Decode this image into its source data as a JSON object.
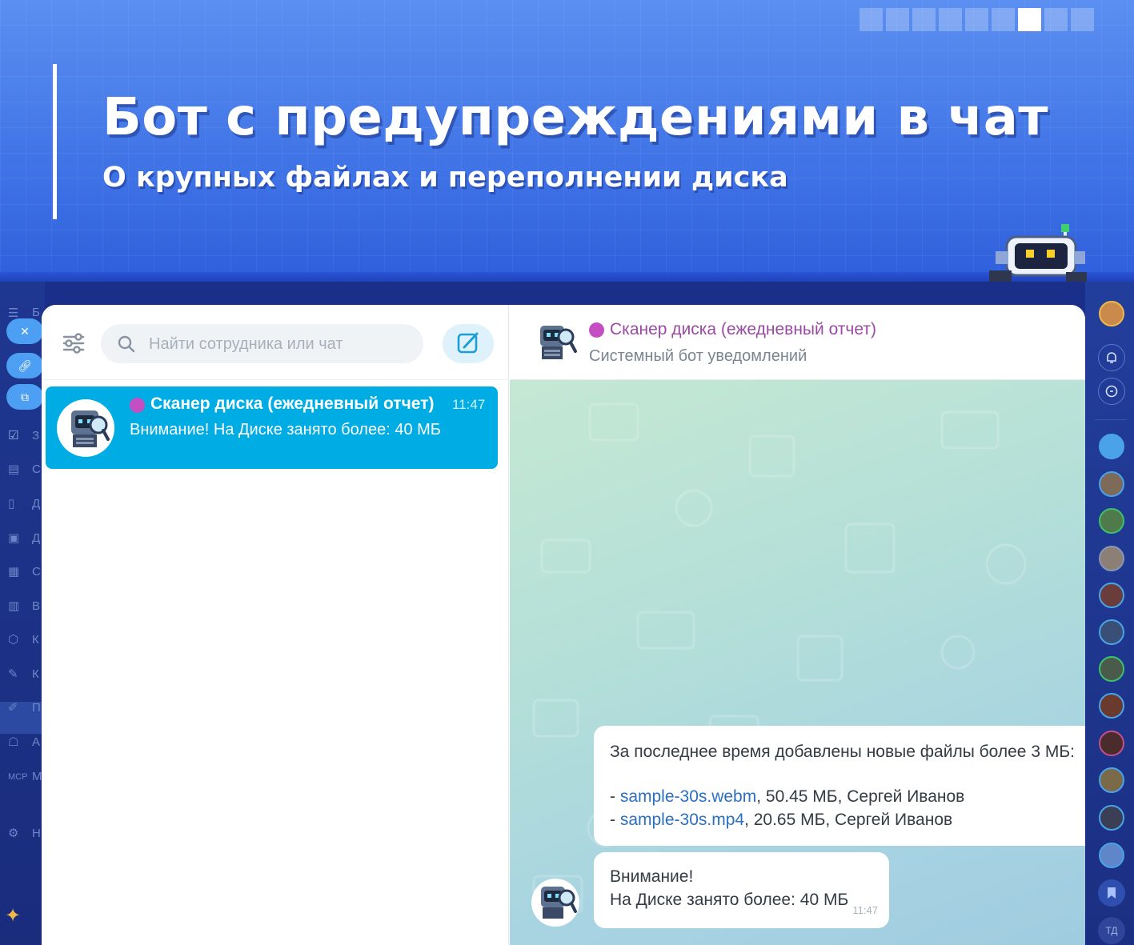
{
  "banner": {
    "title": "Бот с предупреждениями в чат",
    "subtitle": "О крупных файлах и переполнении диска"
  },
  "left_rail": {
    "letters": [
      "Б",
      "З",
      "С",
      "Д",
      "Д",
      "С",
      "В",
      "К",
      "К",
      "П",
      "А",
      "М",
      "Н"
    ],
    "mcp_label": "MCP"
  },
  "chat_list": {
    "search_placeholder": "Найти сотрудника или чат",
    "items": [
      {
        "name": "Сканер диска (ежедневный отчет)",
        "time": "11:47",
        "preview": "Внимание! На Диске занято более: 40 МБ"
      }
    ]
  },
  "conversation": {
    "title": "Сканер диска (ежедневный отчет)",
    "subtitle": "Системный бот уведомлений",
    "messages": [
      {
        "intro": "За последнее время добавлены новые файлы более 3 МБ:",
        "files": [
          {
            "prefix": "- ",
            "name": "sample-30s.webm",
            "details": ", 50.45 МБ, Сергей Иванов"
          },
          {
            "prefix": "- ",
            "name": "sample-30s.mp4",
            "details": ", 20.65 МБ, Сергей Иванов"
          }
        ]
      },
      {
        "line1": "Внимание!",
        "line2": "На Диске занято более: 40 МБ",
        "time": "11:47"
      }
    ]
  },
  "right_rail": {
    "user_initials": "ТД"
  },
  "colors": {
    "accent": "#00ace4",
    "bot_name": "#9a4aa3",
    "link": "#2a6fc0",
    "banner": "#3f73e6"
  }
}
